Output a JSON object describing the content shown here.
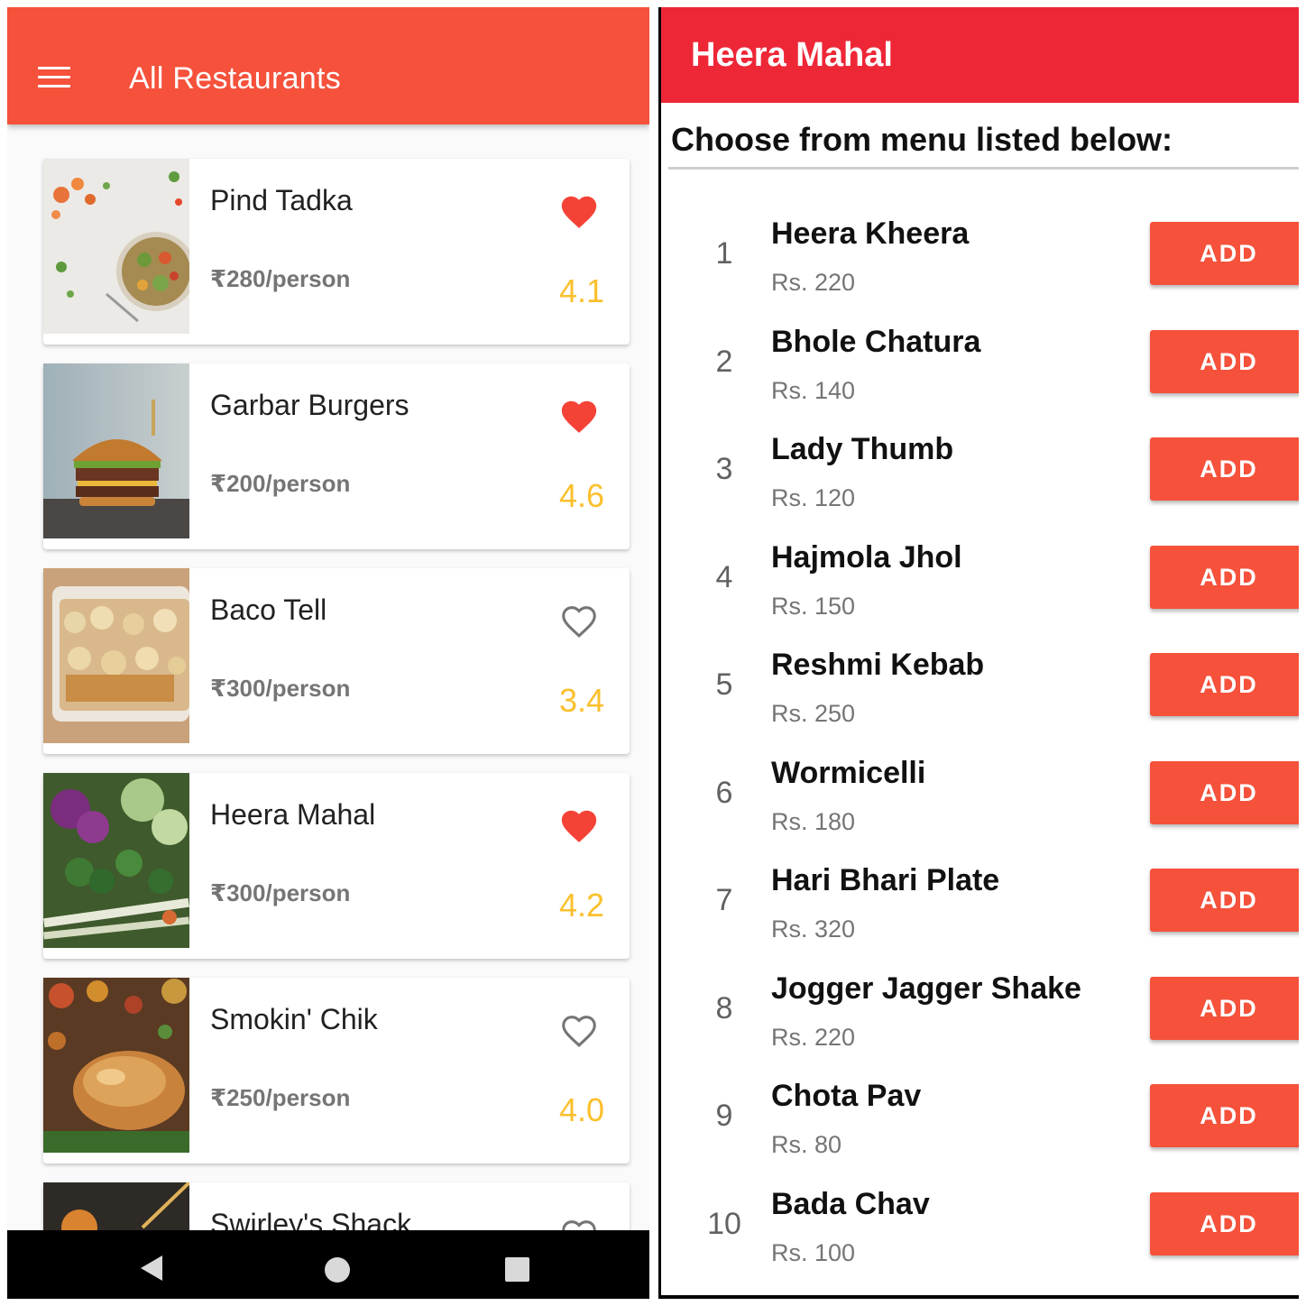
{
  "left": {
    "header": {
      "title": "All Restaurants"
    },
    "restaurants": [
      {
        "name": "Pind Tadka",
        "price": "₹280/person",
        "rating": "4.1",
        "favorite": true,
        "image": "salad-photo"
      },
      {
        "name": "Garbar Burgers",
        "price": "₹200/person",
        "rating": "4.6",
        "favorite": true,
        "image": "burger-photo"
      },
      {
        "name": "Baco Tell",
        "price": "₹300/person",
        "rating": "3.4",
        "favorite": false,
        "image": "tacos-photo"
      },
      {
        "name": "Heera Mahal",
        "price": "₹300/person",
        "rating": "4.2",
        "favorite": true,
        "image": "vegetables-photo"
      },
      {
        "name": "Smokin' Chik",
        "price": "₹250/person",
        "rating": "4.0",
        "favorite": false,
        "image": "roast-chicken-photo"
      },
      {
        "name": "Swirley's Shack",
        "price": "",
        "rating": "",
        "favorite": false,
        "image": "dish-photo"
      }
    ]
  },
  "right": {
    "header": {
      "title": "Heera Mahal"
    },
    "subtitle": "Choose from menu listed below:",
    "add_label": "ADD",
    "items": [
      {
        "num": "1",
        "name": "Heera Kheera",
        "price": "Rs. 220"
      },
      {
        "num": "2",
        "name": "Bhole Chatura",
        "price": "Rs. 140"
      },
      {
        "num": "3",
        "name": "Lady Thumb",
        "price": "Rs. 120"
      },
      {
        "num": "4",
        "name": "Hajmola Jhol",
        "price": "Rs. 150"
      },
      {
        "num": "5",
        "name": "Reshmi Kebab",
        "price": "Rs. 250"
      },
      {
        "num": "6",
        "name": "Wormicelli",
        "price": "Rs. 180"
      },
      {
        "num": "7",
        "name": "Hari Bhari Plate",
        "price": "Rs. 320"
      },
      {
        "num": "8",
        "name": "Jogger Jagger Shake",
        "price": "Rs. 220"
      },
      {
        "num": "9",
        "name": "Chota Pav",
        "price": "Rs. 80"
      },
      {
        "num": "10",
        "name": "Bada Chav",
        "price": "Rs. 100"
      }
    ]
  },
  "colors": {
    "list_appbar": "#f5513b",
    "menu_appbar": "#ee2737",
    "add_button": "#f5513b",
    "favorite_heart": "#f44336",
    "rating": "#fbc02d"
  },
  "icons": {
    "menu": "hamburger-menu-icon",
    "favorite_on": "filled-heart-icon",
    "favorite_off": "outline-heart-icon",
    "nav_back": "triangle-back-icon",
    "nav_home": "circle-home-icon",
    "nav_recent": "square-recents-icon"
  }
}
